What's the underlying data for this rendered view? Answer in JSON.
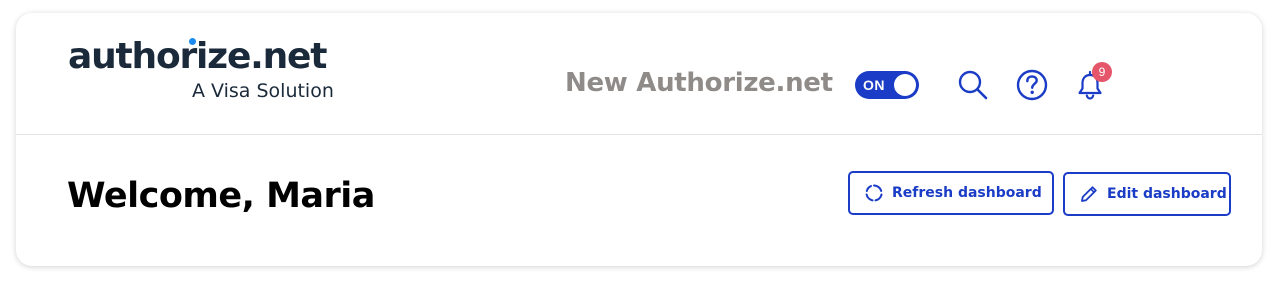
{
  "brand": {
    "logo_text": "authorize.net",
    "tagline": "A Visa Solution"
  },
  "header": {
    "new_experience_label": "New Authorize.net",
    "toggle_state": "ON",
    "notification_count": "9",
    "icons": [
      "search-icon",
      "help-icon",
      "bell-icon"
    ]
  },
  "main": {
    "welcome_text": "Welcome, Maria",
    "refresh_label": "Refresh dashboard",
    "edit_label": "Edit dashboard"
  },
  "colors": {
    "accent": "#1a3cc6",
    "badge": "#e5566a",
    "logo_dark": "#1b2a3b",
    "logo_dot": "#f7b600",
    "logo_i_dot": "#1a8cf0",
    "muted_text": "#8f8b88"
  }
}
